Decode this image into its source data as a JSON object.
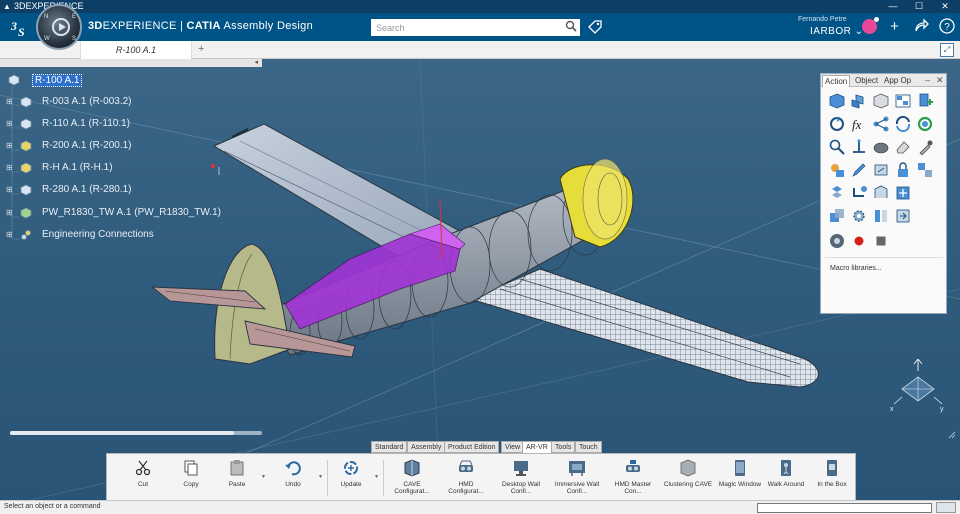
{
  "window": {
    "title": "3DEXPERIENCE"
  },
  "appbar": {
    "brand_a": "3D",
    "brand_b": "EXPERIENCE",
    "brand_sep": " | ",
    "brand_c": "CATIA",
    "brand_d": " Assembly Design",
    "search_placeholder": "Search",
    "user_name": "Fernando Petre",
    "tenant": "IARBOR"
  },
  "tabs": {
    "active": "R-100 A.1",
    "add": "+"
  },
  "tree": {
    "root": "R-100 A.1",
    "items": [
      {
        "label": "R-003 A.1 (R-003.2)"
      },
      {
        "label": "R-110 A.1 (R-110.1)"
      },
      {
        "label": "R-200 A.1 (R-200.1)"
      },
      {
        "label": "R-H A.1 (R-H.1)"
      },
      {
        "label": "R-280 A.1 (R-280.1)"
      },
      {
        "label": "PW_R1830_TW A.1 (PW_R1830_TW.1)"
      },
      {
        "label": "Engineering Connections"
      }
    ]
  },
  "action_panel": {
    "tabs": [
      "Action",
      "Object",
      "App Op"
    ],
    "macro_label": "Macro libraries..."
  },
  "action_bar": {
    "tabs": [
      "Standard",
      "Assembly",
      "Product Edition",
      "View",
      "AR-VR",
      "Tools",
      "Touch"
    ],
    "active_tab": "AR-VR",
    "buttons": [
      {
        "label": "Cut"
      },
      {
        "label": "Copy"
      },
      {
        "label": "Paste"
      },
      {
        "label": "Undo"
      },
      {
        "label": "Update"
      },
      {
        "label": "CAVE Configurat..."
      },
      {
        "label": "HMD Configurat..."
      },
      {
        "label": "Desktop Wall Confi..."
      },
      {
        "label": "Immersive Wall Confi..."
      },
      {
        "label": "HMD Master Con..."
      },
      {
        "label": "Clustering CAVE"
      },
      {
        "label": "Magic Window"
      },
      {
        "label": "Walk Around"
      },
      {
        "label": "In the Box"
      }
    ]
  },
  "statusbar": {
    "text": "Select an object or a command"
  },
  "colors": {
    "appbar": "#005386",
    "viewport": "#2e5a7c",
    "selection": "#2a6fcc",
    "accent_pink": "#e8479a"
  }
}
